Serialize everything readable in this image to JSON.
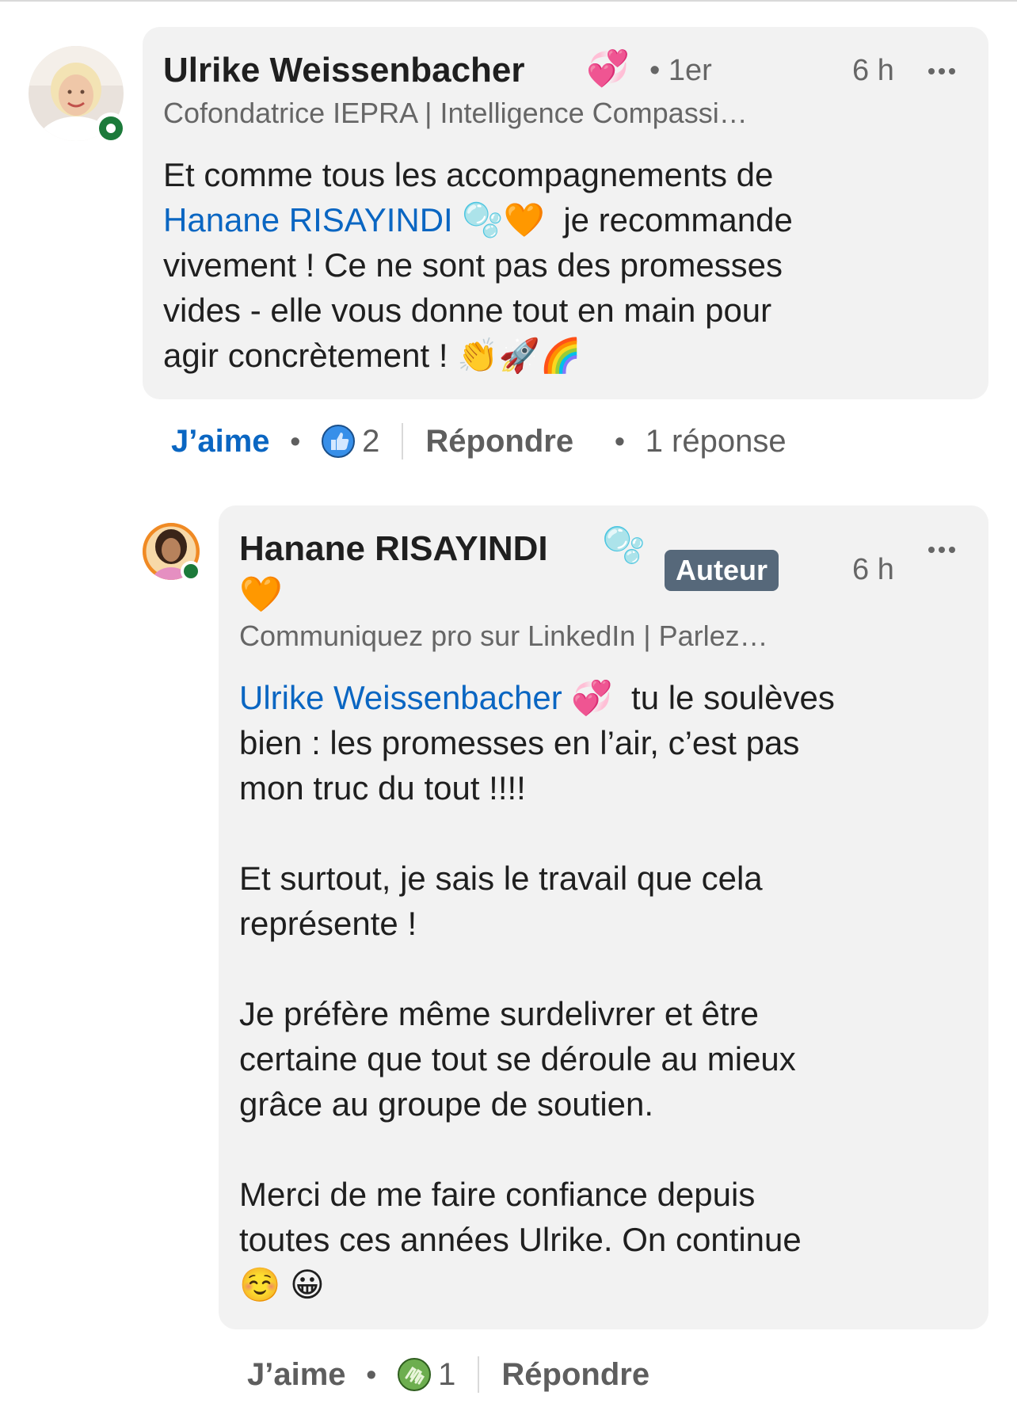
{
  "comments": [
    {
      "author": "Ulrike Weissenbacher",
      "degree": "• 1er",
      "time": "6 h",
      "headline": "Cofondatrice IEPRA | Intelligence Compassi…",
      "mention": "Hanane RISAYINDI",
      "text_line1": "Et comme tous les accompagnements de",
      "text_after_mention": "je recommande",
      "text_line3": "vivement ! Ce ne sont pas des promesses",
      "text_line4": "vides - elle vous donne tout en main pour",
      "text_line5": "agir concrètement !",
      "actions": {
        "like_label": "J’aime",
        "reaction_count": "2",
        "reaction_icon": "thumbs-up-icon",
        "reply_label": "Répondre",
        "replies_label": "1 réponse"
      }
    },
    {
      "author": "Hanane RISAYINDI",
      "badge": "Auteur",
      "time": "6 h",
      "headline": "Communiquez pro sur LinkedIn | Parlez…",
      "mention": "Ulrike Weissenbacher",
      "text_after_mention": "tu le soulèves",
      "text_line2": "bien : les promesses en l’air, c’est pas",
      "text_line3": "mon truc du tout !!!!",
      "para2_line1": "Et surtout, je sais le travail que cela",
      "para2_line2": "représente !",
      "para3_line1": "Je préfère même surdelivrer et être",
      "para3_line2": "certaine que tout se déroule au mieux",
      "para3_line3": "grâce au groupe de soutien.",
      "para4_line1": "Merci de me faire confiance depuis",
      "para4_line2": "toutes ces années Ulrike. On continue",
      "actions": {
        "like_label": "J’aime",
        "reaction_count": "1",
        "reaction_icon": "clapping-hands-icon",
        "reply_label": "Répondre"
      }
    }
  ],
  "colors": {
    "link": "#0a66c2",
    "bubble": "#f2f2f2",
    "muted": "#666666",
    "online": "#1c7a3a",
    "badge": "#56687a"
  }
}
